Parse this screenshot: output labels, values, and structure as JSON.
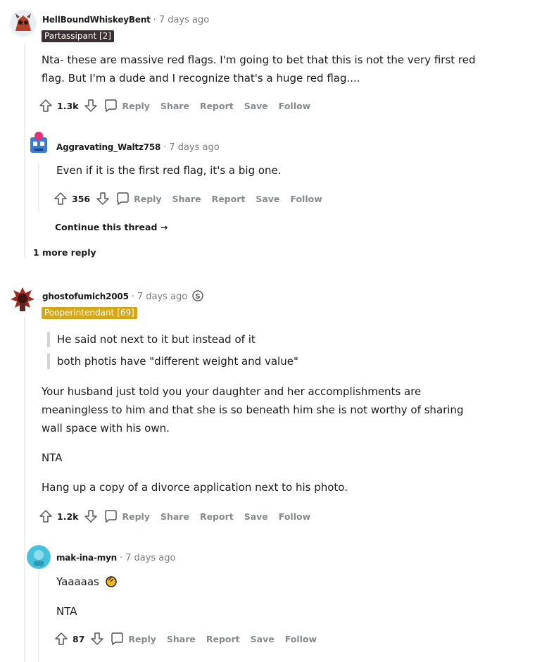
{
  "actions": {
    "reply": "Reply",
    "share": "Share",
    "report": "Report",
    "save": "Save",
    "follow": "Follow"
  },
  "comments": [
    {
      "author": "HellBoundWhiskeyBent",
      "sep": "·",
      "time": "7 days ago",
      "flair": "Partassipant [2]",
      "body": [
        "Nta- these are massive red flags. I'm going to bet that this is not the very first red",
        "flag. But I'm a dude and I recognize that's a huge red flag...."
      ],
      "score": "1.3k"
    },
    {
      "author": "Aggravating_Waltz758",
      "sep": "·",
      "time": "7 days ago",
      "body": [
        "Even if it is the first red flag, it's a big one."
      ],
      "score": "356",
      "continue": "Continue this thread →"
    },
    {
      "more": "1 more reply"
    },
    {
      "author": "ghostofumich2005",
      "sep": "·",
      "time": "7 days ago",
      "flair": "Pooperintendant [69]",
      "quotes": [
        "He said not next to it but instead of it",
        "both photis have \"different weight and value\""
      ],
      "body": [
        "Your husband just told you your daughter and her accomplishments are",
        "meaningless to him and that she is so beneath him she is not worthy of sharing",
        "wall space with his own."
      ],
      "body2": "NTA",
      "body3": "Hang up a copy of a divorce application next to his photo.",
      "score": "1.2k"
    },
    {
      "author": "mak-ina-myn",
      "sep": "·",
      "time": "7 days ago",
      "body": "Yaaaaas",
      "body2": "NTA",
      "score": "87"
    }
  ]
}
